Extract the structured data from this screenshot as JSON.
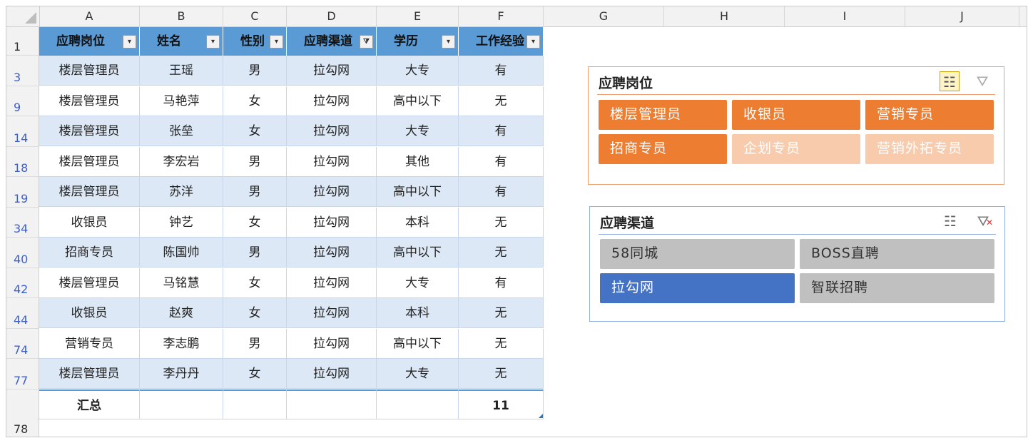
{
  "columns": [
    "A",
    "B",
    "C",
    "D",
    "E",
    "F",
    "G",
    "H",
    "I",
    "J"
  ],
  "table": {
    "headers": [
      "应聘岗位",
      "姓名",
      "性别",
      "应聘渠道",
      "学历",
      "工作经验"
    ],
    "rows": [
      {
        "n": "3",
        "c": [
          "楼层管理员",
          "王瑶",
          "男",
          "拉勾网",
          "大专",
          "有"
        ]
      },
      {
        "n": "9",
        "c": [
          "楼层管理员",
          "马艳萍",
          "女",
          "拉勾网",
          "高中以下",
          "无"
        ]
      },
      {
        "n": "14",
        "c": [
          "楼层管理员",
          "张垒",
          "女",
          "拉勾网",
          "大专",
          "有"
        ]
      },
      {
        "n": "18",
        "c": [
          "楼层管理员",
          "李宏岩",
          "男",
          "拉勾网",
          "其他",
          "有"
        ]
      },
      {
        "n": "19",
        "c": [
          "楼层管理员",
          "苏洋",
          "男",
          "拉勾网",
          "高中以下",
          "有"
        ]
      },
      {
        "n": "34",
        "c": [
          "收银员",
          "钟艺",
          "女",
          "拉勾网",
          "本科",
          "无"
        ]
      },
      {
        "n": "40",
        "c": [
          "招商专员",
          "陈国帅",
          "男",
          "拉勾网",
          "高中以下",
          "无"
        ]
      },
      {
        "n": "42",
        "c": [
          "楼层管理员",
          "马铭慧",
          "女",
          "拉勾网",
          "大专",
          "有"
        ]
      },
      {
        "n": "44",
        "c": [
          "收银员",
          "赵爽",
          "女",
          "拉勾网",
          "本科",
          "无"
        ]
      },
      {
        "n": "74",
        "c": [
          "营销专员",
          "李志鹏",
          "男",
          "拉勾网",
          "高中以下",
          "无"
        ]
      },
      {
        "n": "77",
        "c": [
          "楼层管理员",
          "李丹丹",
          "女",
          "拉勾网",
          "大专",
          "无"
        ]
      }
    ],
    "header_row_num": "1",
    "total_row": {
      "n": "78",
      "label": "汇总",
      "value": "11"
    }
  },
  "slicer_position": {
    "title": "应聘岗位",
    "items": [
      {
        "label": "楼层管理员",
        "selected": true
      },
      {
        "label": "收银员",
        "selected": true
      },
      {
        "label": "营销专员",
        "selected": true
      },
      {
        "label": "招商专员",
        "selected": true
      },
      {
        "label": "企划专员",
        "selected": false
      },
      {
        "label": "营销外拓专员",
        "selected": false
      }
    ],
    "colors": {
      "border": "#f0a070",
      "selected": "#ed7d31",
      "unselected": "#f8cbad",
      "selected_text": "#ffffff",
      "unselected_text": "#ffffff"
    }
  },
  "slicer_channel": {
    "title": "应聘渠道",
    "items": [
      {
        "label": "58同城",
        "selected": false
      },
      {
        "label": "BOSS直聘",
        "selected": false
      },
      {
        "label": "拉勾网",
        "selected": true
      },
      {
        "label": "智联招聘",
        "selected": false
      }
    ],
    "colors": {
      "border": "#8fb0e0",
      "selected": "#4472c4",
      "unselected": "#c0c0c0",
      "selected_text": "#ffffff",
      "unselected_text": "#333333"
    }
  },
  "icons": {
    "multi_select": "multi-select-icon",
    "clear_filter": "clear-filter-icon",
    "filter_dropdown": "filter-dropdown-icon"
  }
}
